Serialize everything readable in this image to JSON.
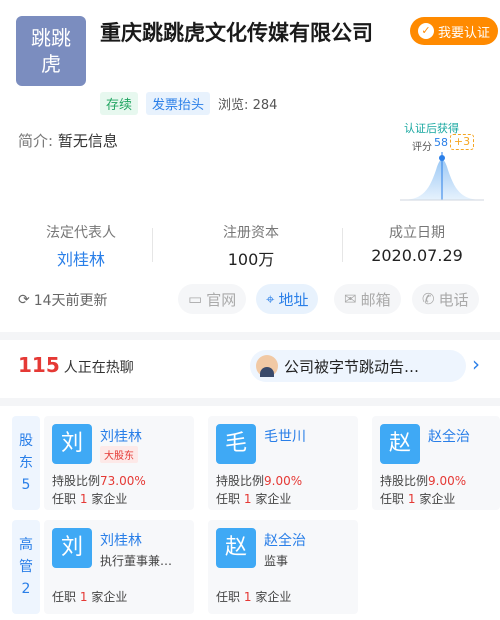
{
  "company": {
    "logo_line1": "跳跳",
    "logo_line2": "虎",
    "name": "重庆跳跳虎文化传媒有限公司",
    "cert_button": "我要认证",
    "status_tag": "存续",
    "invoice_tag": "发票抬头",
    "views_label": "浏览:",
    "views": "284",
    "intro_label": "简介:",
    "intro_value": "暂无信息"
  },
  "score": {
    "title": "认证后获得",
    "label": "评分",
    "value": "58",
    "bonus": "+3"
  },
  "stats": [
    {
      "title": "法定代表人",
      "value": "刘桂林"
    },
    {
      "title": "注册资本",
      "value": "100万"
    },
    {
      "title": "成立日期",
      "value": "2020.07.29"
    }
  ],
  "update_text": "14天前更新",
  "actions": [
    {
      "label": "官网",
      "icon": "monitor-icon"
    },
    {
      "label": "地址",
      "icon": "location-pin-icon"
    },
    {
      "label": "邮箱",
      "icon": "mail-icon"
    },
    {
      "label": "电话",
      "icon": "phone-icon"
    }
  ],
  "chat": {
    "count": "115",
    "text": "人正在热聊",
    "news": "公司被字节跳动告…"
  },
  "shareholders_section": {
    "label_1": "股",
    "label_2": "东",
    "count": "5"
  },
  "management_section": {
    "label_1": "高",
    "label_2": "管",
    "count": "2"
  },
  "shareholders": [
    {
      "avatar": "刘",
      "name": "刘桂林",
      "badge": "大股东",
      "ratio_label": "持股比例",
      "ratio": "73.00%",
      "job_prefix": "任职",
      "job_count": "1",
      "job_suffix": "家企业"
    },
    {
      "avatar": "毛",
      "name": "毛世川",
      "ratio_label": "持股比例",
      "ratio": "9.00%",
      "job_prefix": "任职",
      "job_count": "1",
      "job_suffix": "家企业"
    },
    {
      "avatar": "赵",
      "name": "赵全治",
      "ratio_label": "持股比例",
      "ratio": "9.00%",
      "job_prefix": "任职",
      "job_count": "1",
      "job_suffix": "家企业"
    }
  ],
  "managers": [
    {
      "avatar": "刘",
      "name": "刘桂林",
      "role": "执行董事兼…",
      "job_prefix": "任职",
      "job_count": "1",
      "job_suffix": "家企业"
    },
    {
      "avatar": "赵",
      "name": "赵全治",
      "role": "监事",
      "job_prefix": "任职",
      "job_count": "1",
      "job_suffix": "家企业"
    }
  ],
  "colors": {
    "accent": "#2a7fe8",
    "highlight": "#e53935",
    "cert": "#ff8a00",
    "status": "#21a561"
  }
}
